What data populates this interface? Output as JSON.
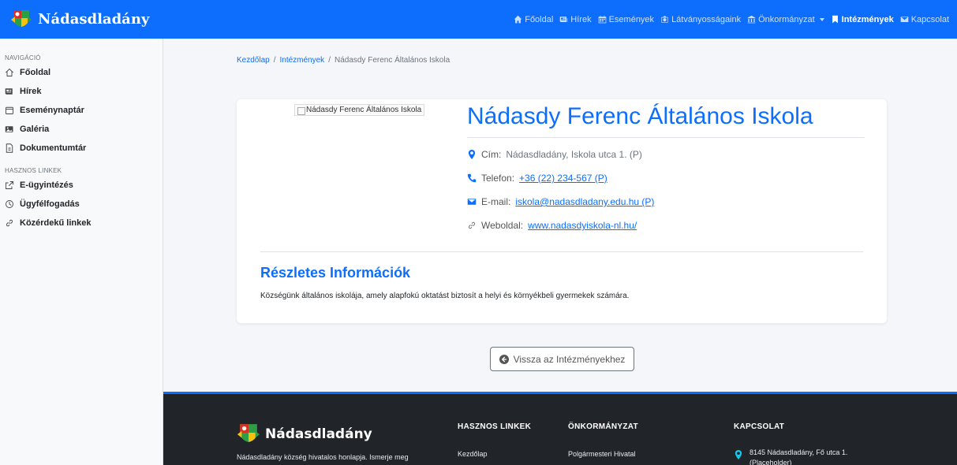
{
  "brand": {
    "name": "Nádasdladány"
  },
  "nav": [
    {
      "label": "Főoldal",
      "icon": "home-icon",
      "active": false
    },
    {
      "label": "Hírek",
      "icon": "newspaper-icon",
      "active": false
    },
    {
      "label": "Események",
      "icon": "calendar-icon",
      "active": false
    },
    {
      "label": "Látványosságaink",
      "icon": "camera-icon",
      "active": false
    },
    {
      "label": "Önkormányzat",
      "icon": "building-icon",
      "active": false,
      "dropdown": true
    },
    {
      "label": "Intézmények",
      "icon": "bookmark-icon",
      "active": true
    },
    {
      "label": "Kapcsolat",
      "icon": "envelope-icon",
      "active": false
    }
  ],
  "sidebar": {
    "nav_heading": "NAVIGÁCIÓ",
    "nav_items": [
      {
        "label": "Főoldal",
        "icon": "house-icon"
      },
      {
        "label": "Hírek",
        "icon": "newspaper-icon"
      },
      {
        "label": "Eseménynaptár",
        "icon": "calendar-icon"
      },
      {
        "label": "Galéria",
        "icon": "images-icon"
      },
      {
        "label": "Dokumentumtár",
        "icon": "document-icon"
      }
    ],
    "links_heading": "HASZNOS LINKEK",
    "link_items": [
      {
        "label": "E-ügyintézés",
        "icon": "external-link-icon"
      },
      {
        "label": "Ügyfélfogadás",
        "icon": "clock-icon"
      },
      {
        "label": "Közérdekű linkek",
        "icon": "link-icon"
      }
    ]
  },
  "breadcrumb": {
    "home": "Kezdőlap",
    "section": "Intézmények",
    "current": "Nádasdy Ferenc Általános Iskola",
    "separator": "/"
  },
  "institution": {
    "image_alt": "Nádasdy Ferenc Általános Iskola",
    "name": "Nádasdy Ferenc Általános Iskola",
    "address_label": "Cím:",
    "address": "Nádasdladány, Iskola utca 1. (P)",
    "phone_label": "Telefon:",
    "phone": "+36 (22) 234-567 (P)",
    "email_label": "E-mail:",
    "email": "iskola@nadasdladany.edu.hu (P)",
    "website_label": "Weboldal:",
    "website": "www.nadasdyiskola-nl.hu/"
  },
  "details": {
    "heading": "Részletes Információk",
    "text": "Községünk általános iskolája, amely alapfokú oktatást biztosít a helyi és környékbeli gyermekek számára."
  },
  "back_button": "Vissza az Intézményekhez",
  "footer": {
    "brand": "Nádasdladány",
    "description": "Nádasdladány község hivatalos honlapja. Ismerje meg",
    "col1_title": "HASZNOS LINKEK",
    "col1_link": "Kezdőlap",
    "col2_title": "ÖNKORMÁNYZAT",
    "col2_link": "Polgármesteri Hivatal",
    "col3_title": "KAPCSOLAT",
    "address_line1": "8145 Nádasdladány, Fő utca 1.",
    "address_line2": "(Placeholder)"
  },
  "colors": {
    "primary": "#0d6efd",
    "footer_bg": "#212529",
    "sidebar_bg": "#f8f9fa",
    "accent_icon": "#0dcaf0"
  }
}
